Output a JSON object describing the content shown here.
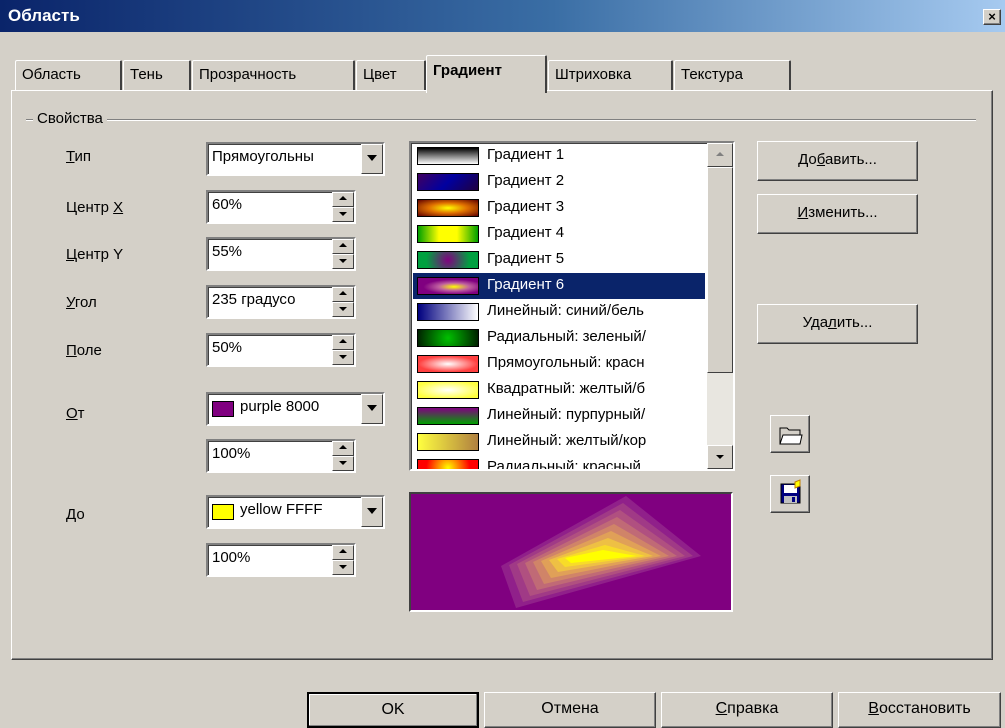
{
  "window": {
    "title": "Область",
    "close_glyph": "×"
  },
  "tabs": [
    {
      "label": "Область"
    },
    {
      "label": "Тень"
    },
    {
      "label": "Прозрачность"
    },
    {
      "label": "Цвет"
    },
    {
      "label": "Градиент",
      "active": true
    },
    {
      "label": "Штриховка"
    },
    {
      "label": "Текстура"
    }
  ],
  "properties": {
    "group_label": "Свойства",
    "type": {
      "label_u": "Т",
      "label_rest": "ип",
      "value": "Прямоугольны"
    },
    "center_x": {
      "label_pre": "Центр ",
      "label_u": "X",
      "value": "60%"
    },
    "center_y": {
      "label_u": "Ц",
      "label_rest": "ентр Y",
      "value": "55%"
    },
    "angle": {
      "label_u": "У",
      "label_rest": "гол",
      "value": "235 градусо"
    },
    "border": {
      "label_u": "П",
      "label_rest": "оле",
      "value": "50%"
    },
    "from": {
      "label_u": "О",
      "label_rest": "т",
      "color_value": "purple 8000",
      "color_hex": "#800080",
      "intensity": "100%"
    },
    "to": {
      "label_u": "Д",
      "label_rest": "о",
      "color_value": "yellow FFFF",
      "color_hex": "#ffff00",
      "intensity": "100%"
    }
  },
  "gradient_list": {
    "selected_index": 5,
    "items": [
      {
        "label": "Градиент 1"
      },
      {
        "label": "Градиент 2"
      },
      {
        "label": "Градиент 3"
      },
      {
        "label": "Градиент 4"
      },
      {
        "label": "Градиент 5"
      },
      {
        "label": "Градиент 6"
      },
      {
        "label": "Линейный: синий/бель"
      },
      {
        "label": "Радиальный: зеленый/"
      },
      {
        "label": "Прямоугольный: красн"
      },
      {
        "label": "Квадратный: желтый/б"
      },
      {
        "label": "Линейный: пурпурный/"
      },
      {
        "label": "Линейный: желтый/кор"
      },
      {
        "label": "Радиальный: красный"
      }
    ]
  },
  "actions": {
    "add": {
      "pre": "До",
      "u": "б",
      "post": "авить..."
    },
    "modify": {
      "pre": "",
      "u": "И",
      "post": "зменить..."
    },
    "delete": {
      "pre": "Уда",
      "u": "л",
      "post": "ить..."
    },
    "load_icon": "folder-open-icon",
    "save_icon": "floppy-disk-icon"
  },
  "footer": {
    "ok": "OK",
    "cancel": "Отмена",
    "help": {
      "u": "С",
      "post": "правка"
    },
    "reset": {
      "u": "В",
      "post": "осстановить"
    }
  }
}
